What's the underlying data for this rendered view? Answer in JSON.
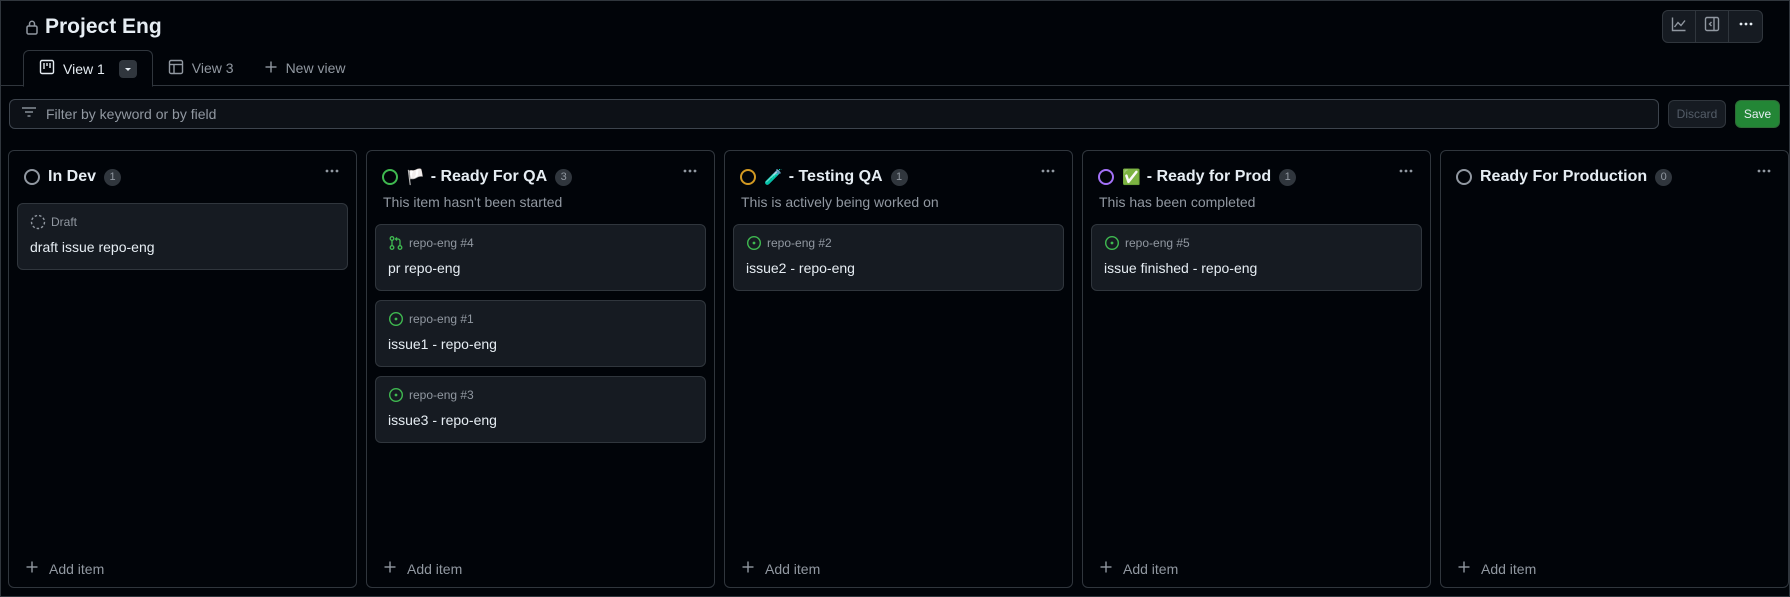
{
  "project": {
    "title": "Project Eng"
  },
  "top_actions": [
    {
      "icon": "graph-icon"
    },
    {
      "icon": "sidebar-panel-icon"
    },
    {
      "icon": "kebab-menu-icon"
    }
  ],
  "tabs": [
    {
      "label": "View 1",
      "icon": "board-icon",
      "active": true
    },
    {
      "label": "View 3",
      "icon": "table-icon",
      "active": false
    },
    {
      "label": "New view",
      "icon": "plus-icon",
      "active": false
    }
  ],
  "filter": {
    "placeholder": "Filter by keyword or by field",
    "value": ""
  },
  "actions": {
    "discard_label": "Discard",
    "save_label": "Save"
  },
  "colors": {
    "gray": "#9198a1",
    "green": "#3fb950",
    "orange": "#d29922",
    "purple": "#a371f7",
    "save": "#238636"
  },
  "columns": [
    {
      "title": "In Dev",
      "emoji": "",
      "count": "1",
      "description": "",
      "status_color": "#9198a1",
      "cards": [
        {
          "type": "draft",
          "meta": "Draft",
          "title": "draft issue repo-eng"
        }
      ],
      "add_label": "Add item"
    },
    {
      "title": "- Ready For QA",
      "emoji": "🏳️",
      "count": "3",
      "description": "This item hasn't been started",
      "status_color": "#3fb950",
      "cards": [
        {
          "type": "pr",
          "meta": "repo-eng #4",
          "title": "pr repo-eng"
        },
        {
          "type": "issue",
          "meta": "repo-eng #1",
          "title": "issue1 - repo-eng"
        },
        {
          "type": "issue",
          "meta": "repo-eng #3",
          "title": "issue3 - repo-eng"
        }
      ],
      "add_label": "Add item"
    },
    {
      "title": "- Testing QA",
      "emoji": "🧪",
      "count": "1",
      "description": "This is actively being worked on",
      "status_color": "#d29922",
      "cards": [
        {
          "type": "issue",
          "meta": "repo-eng #2",
          "title": "issue2 - repo-eng"
        }
      ],
      "add_label": "Add item"
    },
    {
      "title": "- Ready for Prod",
      "emoji": "✅",
      "count": "1",
      "description": "This has been completed",
      "status_color": "#a371f7",
      "cards": [
        {
          "type": "issue",
          "meta": "repo-eng #5",
          "title": "issue finished - repo-eng"
        }
      ],
      "add_label": "Add item"
    },
    {
      "title": "Ready For Production",
      "emoji": "",
      "count": "0",
      "description": "",
      "status_color": "#9198a1",
      "cards": [],
      "add_label": "Add item"
    }
  ]
}
